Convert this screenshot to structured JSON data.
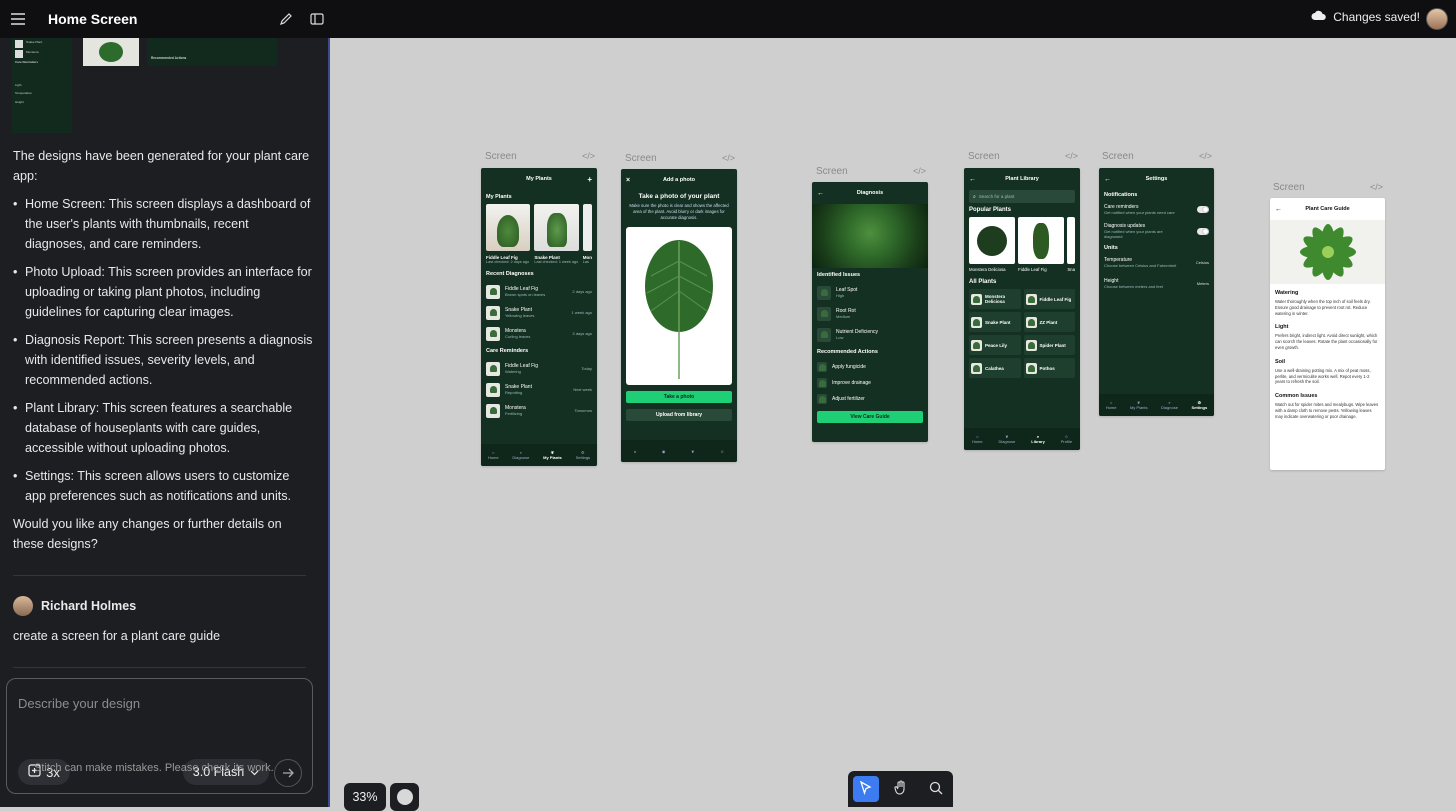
{
  "header": {
    "title": "Home Screen",
    "saved_status": "Changes saved!"
  },
  "sidebar": {
    "thumb_labels": [
      "Snake Plant",
      "Monstera",
      "Care Reminders",
      "Recommended Actions",
      "Light",
      "Temperature",
      "Height"
    ],
    "message_intro": "The designs have been generated for your plant care app:",
    "bullets": [
      "Home Screen: This screen displays a dashboard of the user's plants with thumbnails, recent diagnoses, and care reminders.",
      "Photo Upload: This screen provides an interface for uploading or taking plant photos, including guidelines for capturing clear images.",
      "Diagnosis Report: This screen presents a diagnosis with identified issues, severity levels, and recommended actions.",
      "Plant Library: This screen features a searchable database of houseplants with care guides, accessible without uploading photos.",
      "Settings: This screen allows users to customize app preferences such as notifications and units."
    ],
    "message_outro": "Would you like any changes or further details on these designs?",
    "user_name": "Richard Holmes",
    "user_message": "create a screen for a plant care guide",
    "input_placeholder": "Describe your design",
    "attach_label": "3x",
    "model_label": "3.0 Flash",
    "disclaimer": "Stitch can make mistakes. Please check its work."
  },
  "canvas": {
    "screen_label": "Screen",
    "code_label": "</>",
    "zoom": "33%",
    "screens": {
      "home": {
        "title": "My Plants",
        "section_plants": "My Plants",
        "plants": [
          {
            "name": "Fiddle Leaf Fig",
            "sub": "Last checked: 2 days ago"
          },
          {
            "name": "Snake Plant",
            "sub": "Last checked: 1 week ago"
          },
          {
            "name": "Mon",
            "sub": "Las"
          }
        ],
        "section_diag": "Recent Diagnoses",
        "diagnoses": [
          {
            "name": "Fiddle Leaf Fig",
            "sub": "Brown spots on leaves",
            "when": "2 days ago"
          },
          {
            "name": "Snake Plant",
            "sub": "Yellowing leaves",
            "when": "1 week ago"
          },
          {
            "name": "Monstera",
            "sub": "Curling leaves",
            "when": "3 days ago"
          }
        ],
        "section_care": "Care Reminders",
        "reminders": [
          {
            "name": "Fiddle Leaf Fig",
            "sub": "Watering",
            "when": "Today"
          },
          {
            "name": "Snake Plant",
            "sub": "Repotting",
            "when": "Next week"
          },
          {
            "name": "Monstera",
            "sub": "Fertilizing",
            "when": "Tomorrow"
          }
        ],
        "nav": [
          "Home",
          "Diagnose",
          "My Plants",
          "Settings"
        ]
      },
      "photo": {
        "title": "Add a photo",
        "heading": "Take a photo of your plant",
        "text": "Make sure the photo is clear and shows the affected area of the plant. Avoid blurry or dark images for accurate diagnosis.",
        "btn_take": "Take a photo",
        "btn_upload": "Upload from library"
      },
      "diagnosis": {
        "title": "Diagnosis",
        "section_issues": "Identified Issues",
        "issues": [
          {
            "name": "Leaf Spot",
            "sev": "High"
          },
          {
            "name": "Root Rot",
            "sev": "Medium"
          },
          {
            "name": "Nutrient Deficiency",
            "sev": "Low"
          }
        ],
        "section_actions": "Recommended Actions",
        "actions": [
          "Apply fungicide",
          "Improve drainage",
          "Adjust fertilizer"
        ],
        "btn": "View Care Guide"
      },
      "library": {
        "title": "Plant Library",
        "search_placeholder": "Search for a plant",
        "section_popular": "Popular Plants",
        "popular": [
          "Monstera Deliciosa",
          "Fiddle Leaf Fig",
          "Sna"
        ],
        "section_all": "All Plants",
        "all": [
          "Monstera Deliciosa",
          "Fiddle Leaf Fig",
          "Snake Plant",
          "ZZ Plant",
          "Peace Lily",
          "Spider Plant",
          "Calathea",
          "Pothos"
        ],
        "nav": [
          "Home",
          "Diagnose",
          "Library",
          "Profile"
        ]
      },
      "settings": {
        "title": "Settings",
        "section_notif": "Notifications",
        "care_title": "Care reminders",
        "care_sub": "Get notified when your plants need care",
        "diag_title": "Diagnosis updates",
        "diag_sub": "Get notified when your plants are diagnosed",
        "section_units": "Units",
        "temp_title": "Temperature",
        "temp_sub": "Choose between Celsius and Fahrenheit",
        "temp_val": "Celsius",
        "height_title": "Height",
        "height_sub": "Choose between meters and feet",
        "height_val": "Meters",
        "nav": [
          "Home",
          "My Plants",
          "Diagnose",
          "Settings"
        ]
      },
      "guide": {
        "title": "Plant Care Guide",
        "sections": [
          {
            "h": "Watering",
            "t": "Water thoroughly when the top inch of soil feels dry. Ensure good drainage to prevent root rot. Reduce watering in winter."
          },
          {
            "h": "Light",
            "t": "Prefers bright, indirect light. Avoid direct sunlight, which can scorch the leaves. Rotate the plant occasionally for even growth."
          },
          {
            "h": "Soil",
            "t": "Use a well-draining potting mix. A mix of peat moss, perlite, and vermiculite works well. Repot every 1-2 years to refresh the soil."
          },
          {
            "h": "Common Issues",
            "t": "Watch out for spider mites and mealybugs. Wipe leaves with a damp cloth to remove pests. Yellowing leaves may indicate overwatering or poor drainage."
          }
        ]
      }
    }
  }
}
